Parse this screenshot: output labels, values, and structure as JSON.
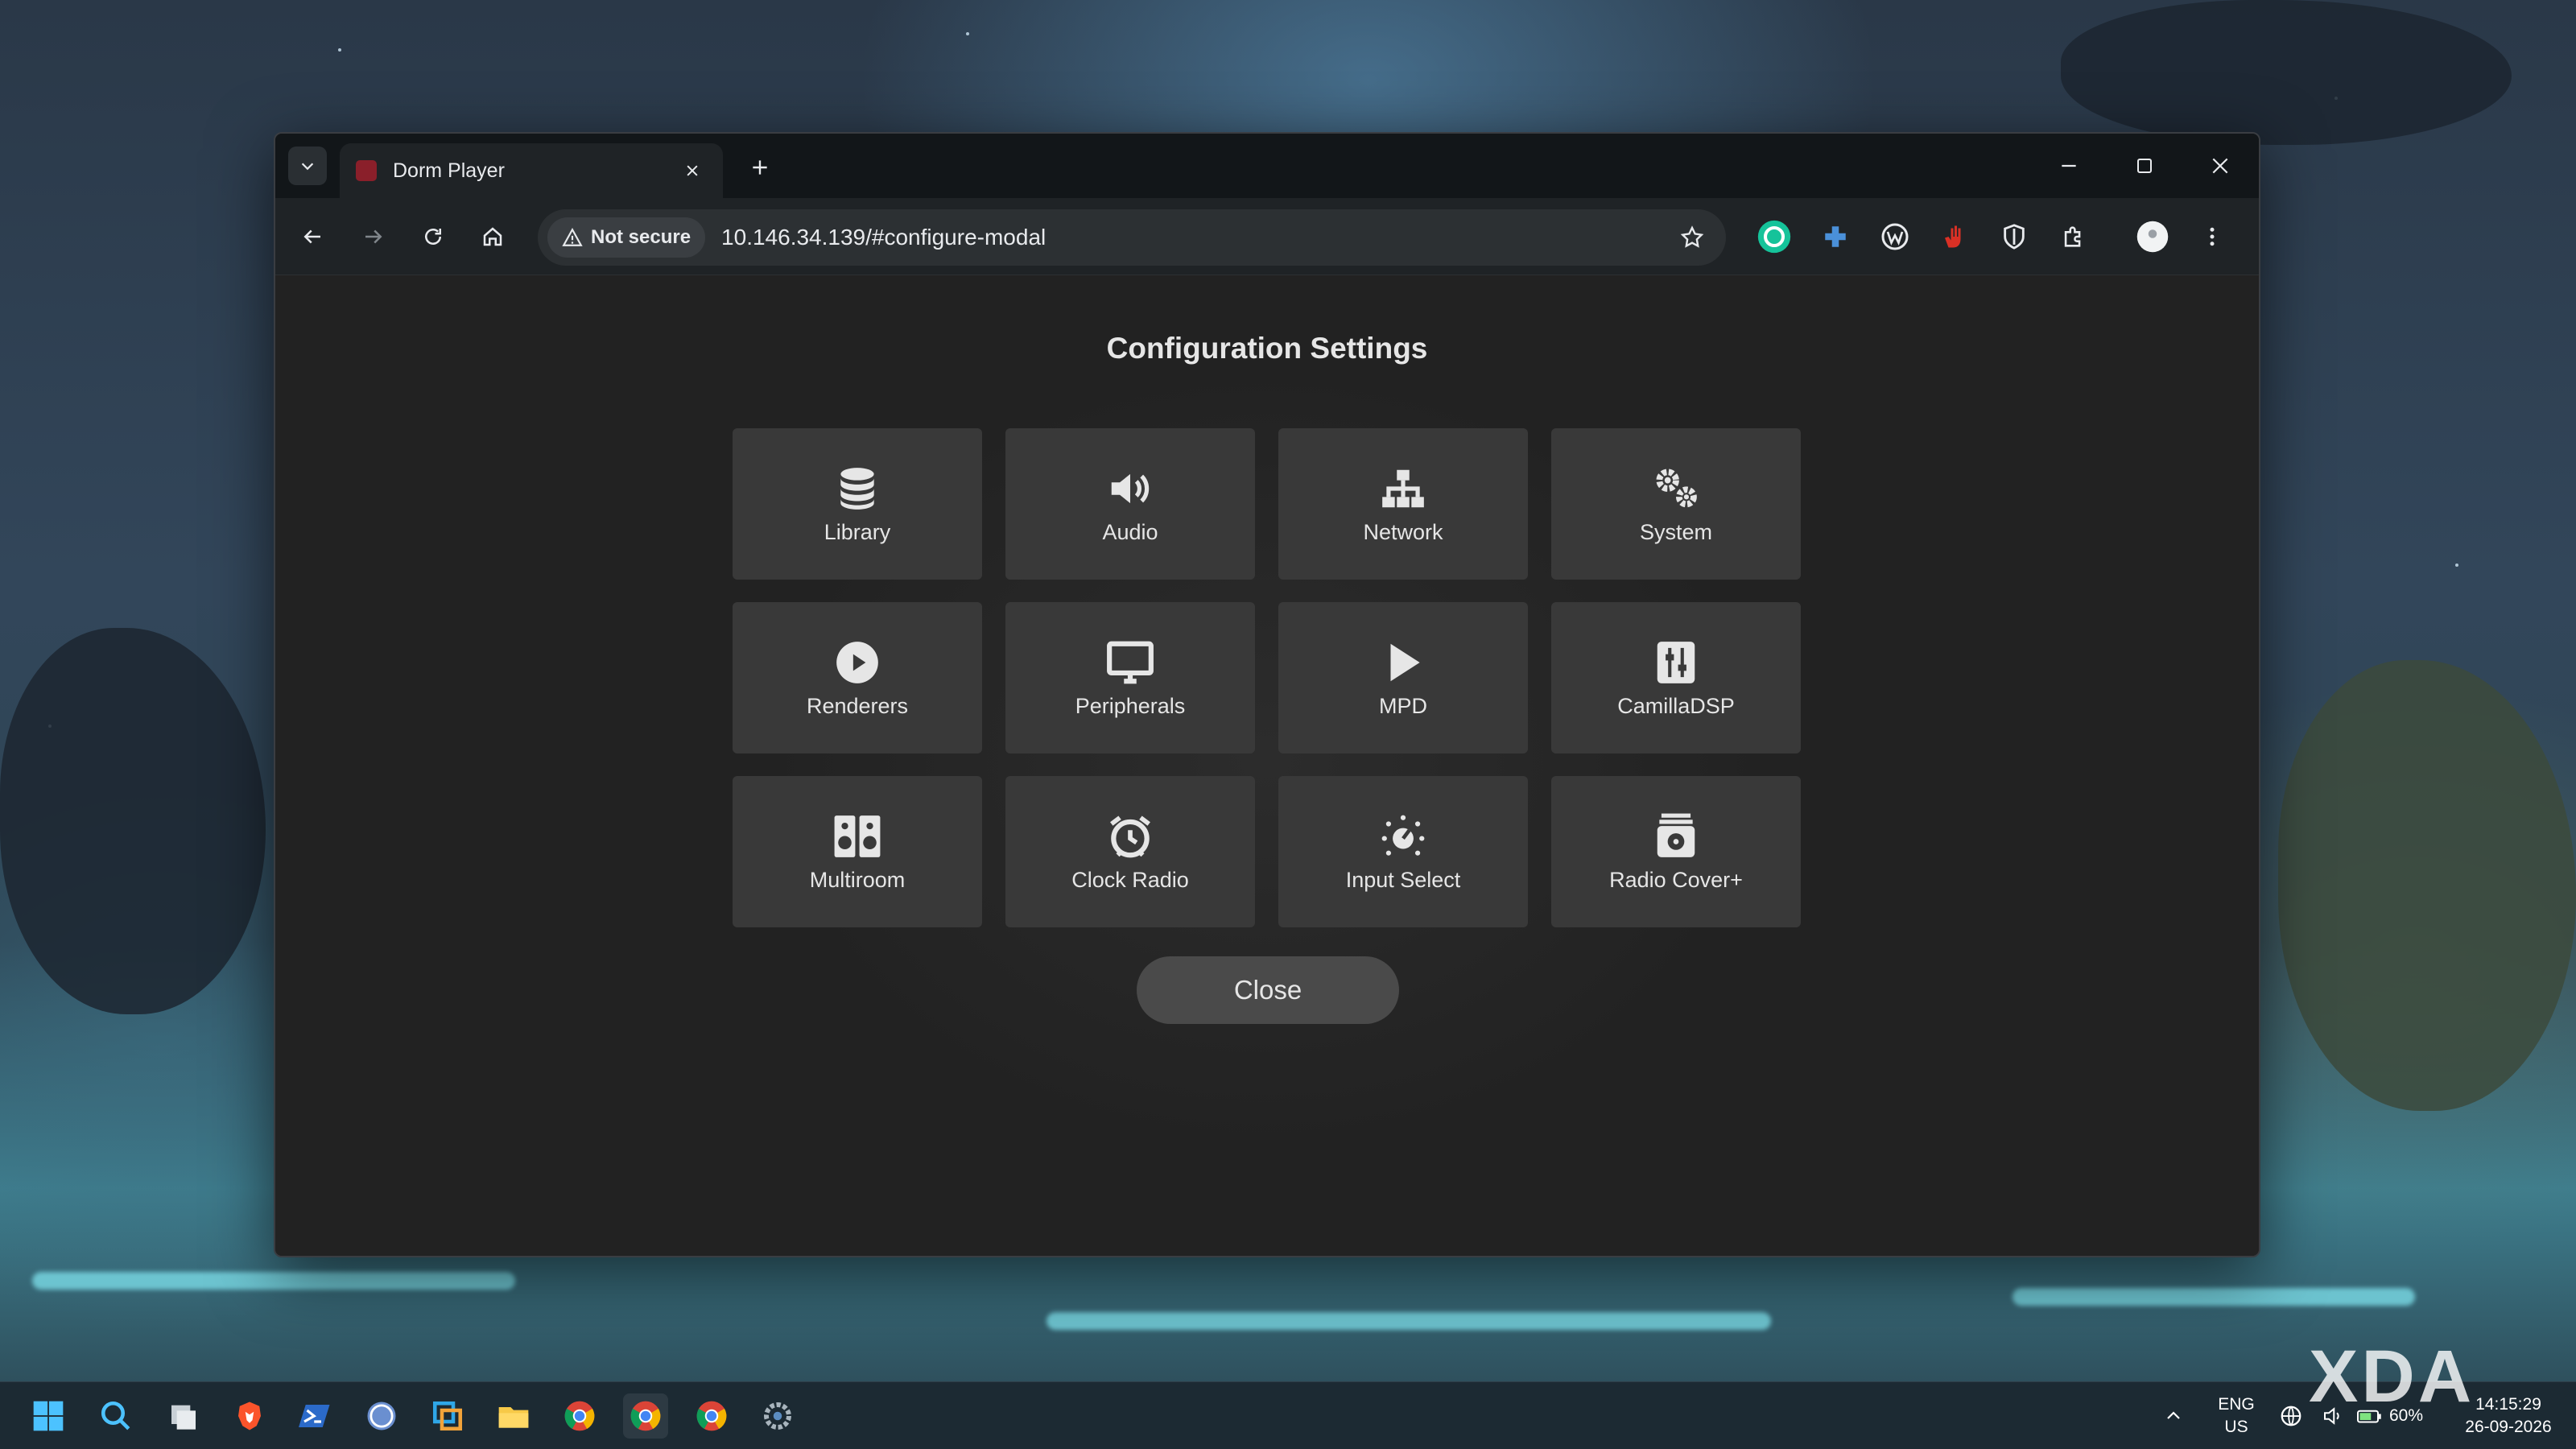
{
  "window": {
    "tab_title": "Dorm Player",
    "security_label": "Not secure",
    "url": "10.146.34.139/#configure-modal"
  },
  "modal": {
    "title": "Configuration Settings",
    "tiles": [
      {
        "label": "Library",
        "icon": "database-icon"
      },
      {
        "label": "Audio",
        "icon": "volume-icon"
      },
      {
        "label": "Network",
        "icon": "sitemap-icon"
      },
      {
        "label": "System",
        "icon": "gears-icon"
      },
      {
        "label": "Renderers",
        "icon": "play-circle-icon"
      },
      {
        "label": "Peripherals",
        "icon": "monitor-icon"
      },
      {
        "label": "MPD",
        "icon": "play-icon"
      },
      {
        "label": "CamillaDSP",
        "icon": "sliders-icon"
      },
      {
        "label": "Multiroom",
        "icon": "speakers-icon"
      },
      {
        "label": "Clock Radio",
        "icon": "alarm-clock-icon"
      },
      {
        "label": "Input Select",
        "icon": "dial-icon"
      },
      {
        "label": "Radio Cover+",
        "icon": "radio-cover-icon"
      }
    ],
    "close_label": "Close"
  },
  "taskbar": {
    "language": "ENG",
    "region": "US",
    "battery": "60%",
    "time": "14:15:29",
    "date": "26-09-2026"
  },
  "watermark": "XDA",
  "colors": {
    "tile_bg": "#393939",
    "modal_bg": "#222222",
    "browser_chrome": "#1f2326",
    "accent_red": "#d93025"
  }
}
